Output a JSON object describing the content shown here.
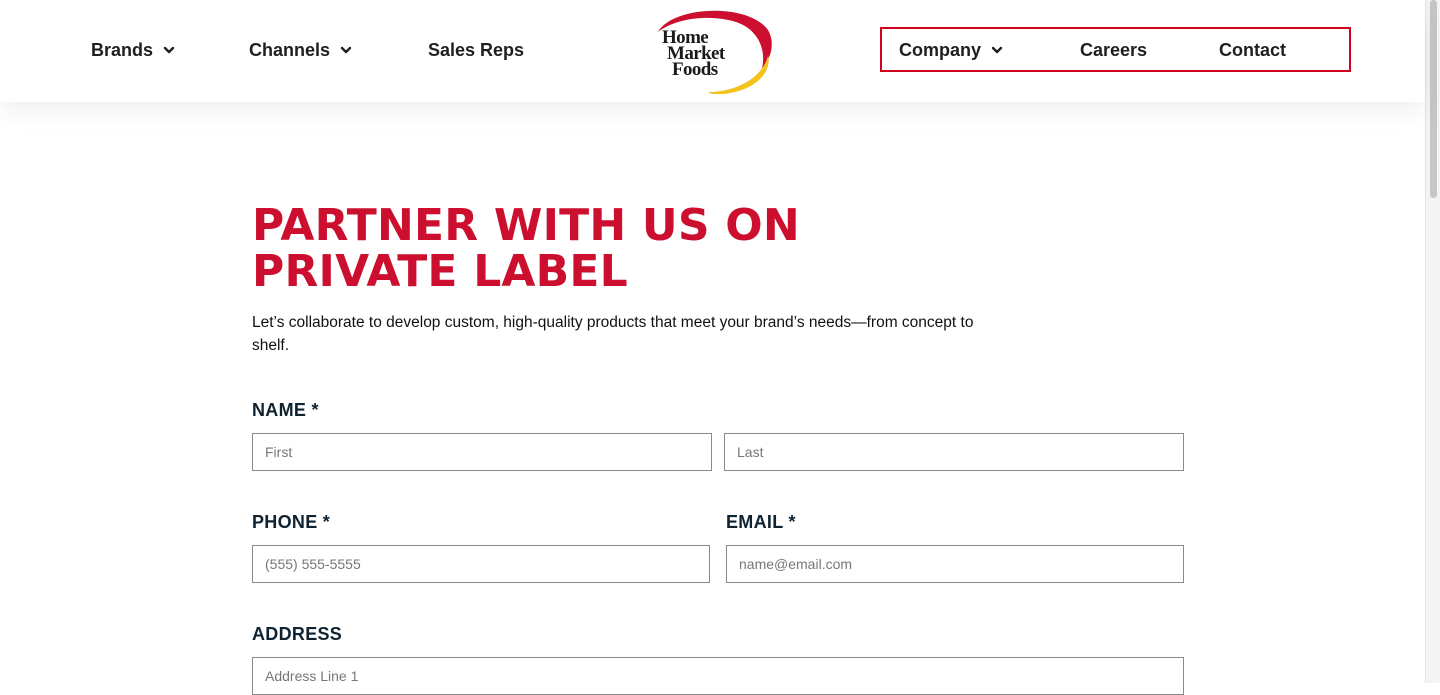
{
  "nav": {
    "left": [
      {
        "label": "Brands",
        "has_dropdown": true
      },
      {
        "label": "Channels",
        "has_dropdown": true
      },
      {
        "label": "Sales Reps",
        "has_dropdown": false
      }
    ],
    "right": [
      {
        "label": "Company",
        "has_dropdown": true
      },
      {
        "label": "Careers",
        "has_dropdown": false
      },
      {
        "label": "Contact",
        "has_dropdown": false
      }
    ],
    "highlight_color": "#d0021b"
  },
  "logo": {
    "text_lines": [
      "Home",
      "Market",
      "Foods"
    ],
    "colors": {
      "arc_red": "#cc0f2f",
      "arc_yellow": "#f3c21b"
    }
  },
  "page": {
    "title_lines": [
      "PARTNER WITH US ON",
      "PRIVATE LABEL"
    ],
    "subtitle": "Let’s collaborate to develop custom, high-quality products that meet your brand’s needs—from concept to shelf.",
    "accent_color": "#cc0f2f"
  },
  "form": {
    "name_label": "NAME *",
    "first_placeholder": "First",
    "last_placeholder": "Last",
    "phone_label": "PHONE *",
    "phone_placeholder": "(555) 555-5555",
    "email_label": "EMAIL *",
    "email_placeholder": "name@email.com",
    "address_label": "ADDRESS",
    "address1_placeholder": "Address Line 1"
  }
}
